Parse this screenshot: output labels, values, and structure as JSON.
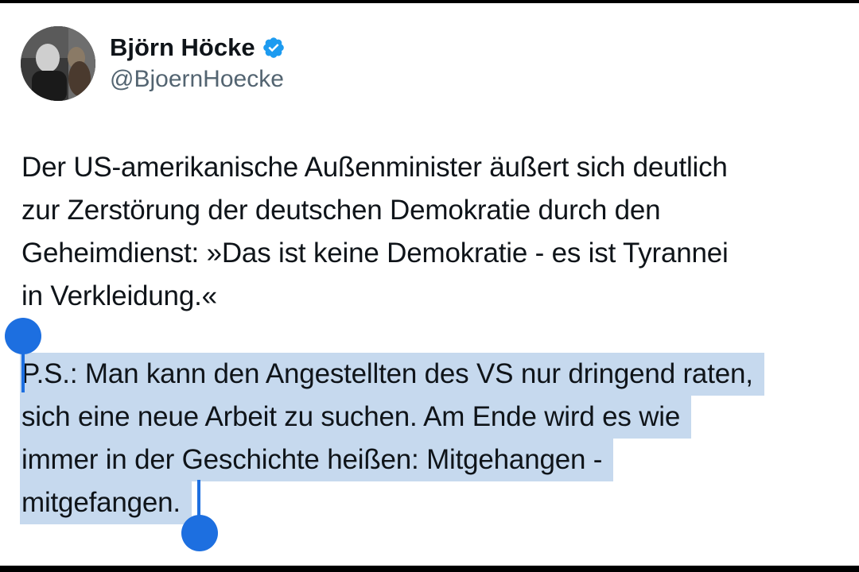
{
  "tweet": {
    "author": {
      "display_name": "Björn Höcke",
      "handle": "@BjoernHoecke",
      "verified_icon": "verified-badge-icon",
      "avatar_icon": "profile-photo"
    },
    "paragraphs": [
      {
        "lines": [
          "Der US-amerikanische Außenminister äußert sich deutlich",
          "zur Zerstörung der deutschen Demokratie durch den",
          "Geheimdienst:  »Das ist keine Demokratie - es ist Tyrannei",
          "in Verkleidung.«"
        ]
      },
      {
        "lines": [
          "P.S.: Man kann den Angestellten des VS nur dringend raten,",
          "sich eine neue Arbeit zu suchen. Am Ende wird es wie",
          "immer in der Geschichte heißen: Mitgehangen -",
          "mitgefangen."
        ],
        "selected": true
      }
    ]
  },
  "colors": {
    "text": "#0f1419",
    "handle": "#536471",
    "verified": "#1d9bf0",
    "selection_bg": "#c6d9ee",
    "selection_handle": "#1d6fe0"
  }
}
